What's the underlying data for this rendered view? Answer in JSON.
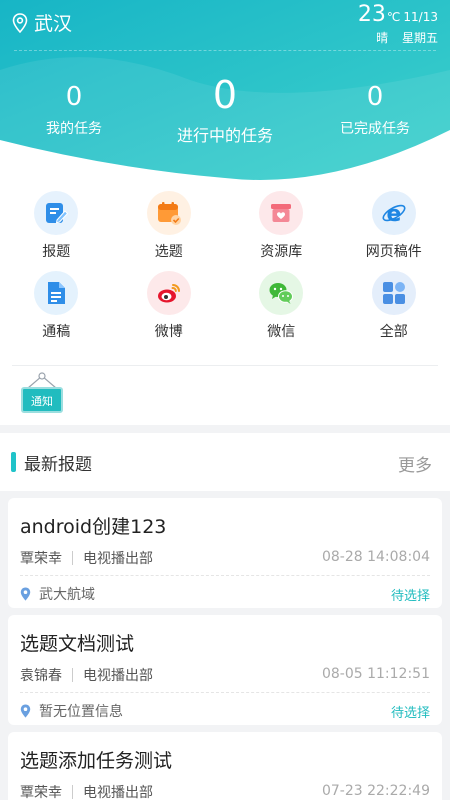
{
  "header": {
    "city": "武汉",
    "temperature": "23",
    "temp_unit": "℃",
    "date": "11/13",
    "weather": "晴",
    "weekday": "星期五"
  },
  "stats": {
    "mine": {
      "value": "0",
      "label": "我的任务"
    },
    "in_progress": {
      "value": "0",
      "label": "进行中的任务"
    },
    "done": {
      "value": "0",
      "label": "已完成任务"
    }
  },
  "grid": {
    "items": [
      {
        "label": "报题",
        "icon": "edit-icon"
      },
      {
        "label": "选题",
        "icon": "calendar-icon"
      },
      {
        "label": "资源库",
        "icon": "resource-box-icon"
      },
      {
        "label": "网页稿件",
        "icon": "ie-browser-icon"
      },
      {
        "label": "通稿",
        "icon": "document-icon"
      },
      {
        "label": "微博",
        "icon": "weibo-icon"
      },
      {
        "label": "微信",
        "icon": "wechat-icon"
      },
      {
        "label": "全部",
        "icon": "all-apps-icon"
      }
    ]
  },
  "notice": {
    "label": "通知"
  },
  "section": {
    "title": "最新报题",
    "more": "更多"
  },
  "cards": [
    {
      "title": "android创建123",
      "author": "覃荣幸",
      "dept": "电视播出部",
      "time": "08-28 14:08:04",
      "place": "武大航域",
      "status": "待选择"
    },
    {
      "title": "选题文档测试",
      "author": "袁锦春",
      "dept": "电视播出部",
      "time": "08-05 11:12:51",
      "place": "暂无位置信息",
      "status": "待选择"
    },
    {
      "title": "选题添加任务测试",
      "author": "覃荣幸",
      "dept": "电视播出部",
      "time": "07-23 22:22:49",
      "place": "",
      "status": ""
    }
  ],
  "colors": {
    "accent": "#20c3c9",
    "header_start": "#1ab8c8",
    "header_end": "#3ed0cc"
  }
}
